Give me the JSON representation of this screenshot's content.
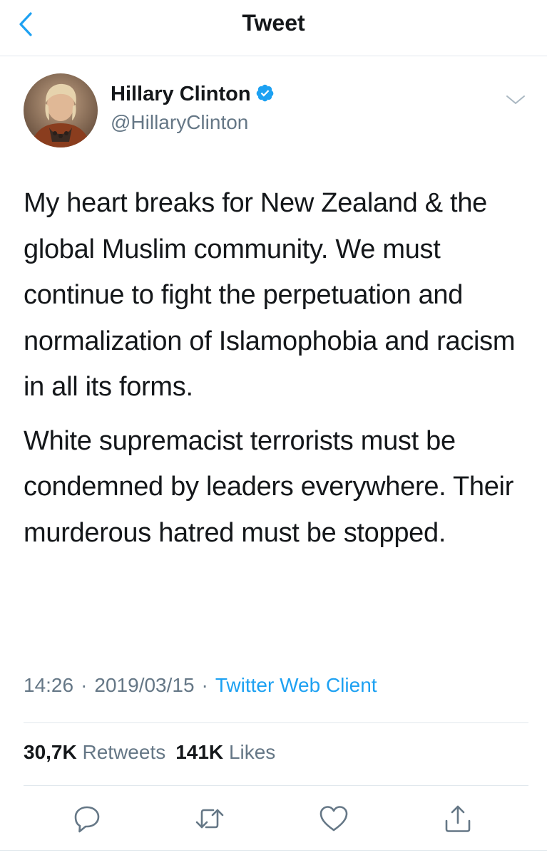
{
  "nav": {
    "title": "Tweet",
    "back_icon": "chevron-left-icon"
  },
  "colors": {
    "accent": "#1da1f2",
    "text": "#14171a",
    "secondary": "#657786",
    "divider": "#e1e8ed"
  },
  "tweet": {
    "author": {
      "name": "Hillary Clinton",
      "handle": "@HillaryClinton",
      "verified": true,
      "avatar": "profile-photo"
    },
    "paragraphs": [
      "My heart breaks for New Zealand & the global Muslim community. We must continue to fight the perpetuation and normalization of Islamophobia and racism in all its forms.",
      "White supremacist terrorists must be condemned by leaders everywhere. Their murderous hatred must be stopped."
    ],
    "time": "14:26",
    "date": "2019/03/15",
    "separator": "·",
    "source": "Twitter Web Client"
  },
  "stats": {
    "retweets_count": "30,7K",
    "retweets_label": "Retweets",
    "likes_count": "141K",
    "likes_label": "Likes"
  },
  "actions": {
    "icons": [
      "reply-icon",
      "retweet-icon",
      "like-icon",
      "share-icon"
    ]
  }
}
